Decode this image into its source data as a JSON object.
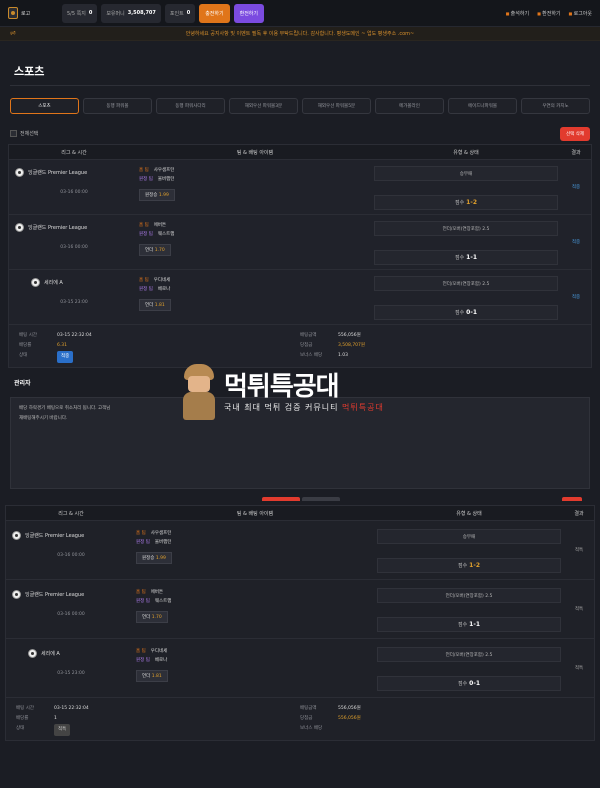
{
  "header": {
    "logo_text": "로고",
    "pills": [
      {
        "label": "5/5 쪽지",
        "value": "0"
      },
      {
        "label": "보유머니",
        "value": "3,508,707"
      },
      {
        "label": "포인트",
        "value": "0"
      }
    ],
    "charge_label": "충전하기",
    "withdraw_label": "환전하기",
    "right_links": [
      "출석하기",
      "환전하기",
      "로그아웃"
    ]
  },
  "notice": "안녕하세요 공지사항 및 이벤트 필독 후 이용 부탁드립니다. 감사합니다. 평생도메인 ~ 업도 평생주소 .com~",
  "page_title": "스포츠",
  "tabs": [
    "스포츠",
    "동행 파워볼",
    "동행 파워사다리",
    "해외우선 파워볼3분",
    "해외우선 파워볼5분",
    "메가볼라인",
    "에이드나파워볼",
    "우연의 카지노"
  ],
  "select_all_label": "전체선택",
  "delete_selected_label": "선택 삭제",
  "table_headers": {
    "time": "리그 & 시간",
    "match": "팀 & 배팅 아이템",
    "type": "유형 & 상태",
    "result": "결과"
  },
  "bets": [
    {
      "league": "잉글랜드 Premier League",
      "time": "03-16 00:00",
      "home_tag": "홈 팀",
      "home": "사우샘프턴",
      "away_tag": "원정 팀",
      "away": "울버햄턴",
      "pick": "원정승",
      "odds": "1.99",
      "type": "승무패",
      "score_label": "점수",
      "score": "1-2",
      "result": "적중"
    },
    {
      "league": "잉글랜드 Premier League",
      "time": "03-16 00:00",
      "home_tag": "홈 팀",
      "home": "에버튼",
      "away_tag": "원정 팀",
      "away": "웨스트햄",
      "pick": "언더",
      "odds": "1.70",
      "type": "언더/오버(연장포함) 2.5",
      "score_label": "점수",
      "score": "1-1",
      "result": "적중"
    },
    {
      "league": "세리에 A",
      "time": "03-15 23:00",
      "home_tag": "홈 팀",
      "home": "우디네세",
      "away_tag": "원정 팀",
      "away": "베로나",
      "pick": "언더",
      "odds": "1.81",
      "type": "언더/오버(연장포함) 2.5",
      "score_label": "점수",
      "score": "0-1",
      "result": "적중"
    }
  ],
  "summary": {
    "bet_time_label": "배팅 시간",
    "bet_time": "03-15 22:32:04",
    "odds_label": "배당률",
    "odds": "6.31",
    "status_label": "상태",
    "status": "적중",
    "amount_label": "배팅금액",
    "amount": "556,056원",
    "win_label": "당첨금",
    "win": "3,508,707원",
    "bonus_label": "보너스 배당",
    "bonus": "1.03"
  },
  "admin": {
    "title": "관리자",
    "lines": [
      "배당 하락경기 배팅으로 취소처리 됩니다. 고객님",
      "재배팅해주시기 바랍니다."
    ]
  },
  "watermark": {
    "big_1": "먹튀",
    "big_2": "특공대",
    "small_1": "국내 최대 먹튀 검증 커뮤니티",
    "small_2": "먹튀특공대"
  },
  "bets2": [
    {
      "league": "잉글랜드 Premier League",
      "time": "03-16 00:00",
      "home_tag": "홈 팀",
      "home": "사우샘프턴",
      "away_tag": "원정 팀",
      "away": "울버햄턴",
      "pick": "원정승",
      "odds": "1.99",
      "type": "승무패",
      "score_label": "점수",
      "score": "1-2",
      "result": "적특"
    },
    {
      "league": "잉글랜드 Premier League",
      "time": "03-16 00:00",
      "home_tag": "홈 팀",
      "home": "에버튼",
      "away_tag": "원정 팀",
      "away": "웨스트햄",
      "pick": "언더",
      "odds": "1.70",
      "type": "언더/오버(연장포함) 2.5",
      "score_label": "점수",
      "score": "1-1",
      "result": "적특"
    },
    {
      "league": "세리에 A",
      "time": "03-15 23:00",
      "home_tag": "홈 팀",
      "home": "우디네세",
      "away_tag": "원정 팀",
      "away": "베로나",
      "pick": "언더",
      "odds": "1.81",
      "type": "언더/오버(연장포함) 2.5",
      "score_label": "점수",
      "score": "0-1",
      "result": "적특"
    }
  ],
  "summary2": {
    "bet_time_label": "배팅 시간",
    "bet_time": "03-15 22:32:04",
    "odds_label": "배당률",
    "odds": "1",
    "status_label": "상태",
    "status": "적특",
    "amount_label": "배팅금액",
    "amount": "556,056원",
    "win_label": "당첨금",
    "win": "556,056원",
    "bonus_label": "보너스 배당",
    "bonus": ""
  }
}
